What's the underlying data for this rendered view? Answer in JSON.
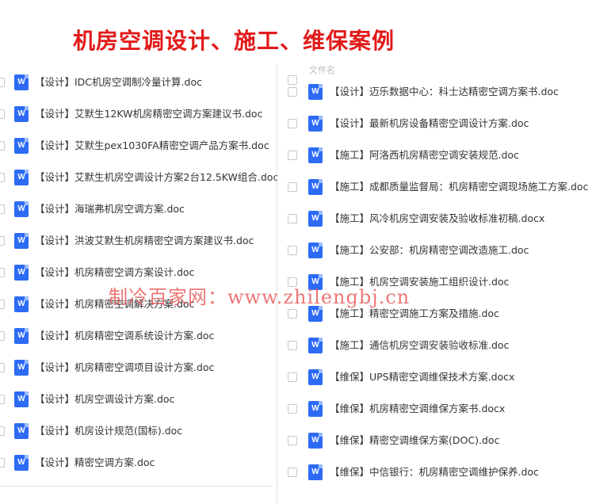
{
  "banner": {
    "title": "机房空调设计、施工、维保案例"
  },
  "right_header": {
    "label": "文件名"
  },
  "left_files": [
    "【设计】IDC机房空调制冷量计算.doc",
    "【设计】艾默生12KW机房精密空调方案建议书.doc",
    "【设计】艾默生pex1030FA精密空调产品方案书.doc",
    "【设计】艾默生机房空调设计方案2台12.5KW组合.doc",
    "【设计】海瑞弗机房空调方案.doc",
    "【设计】洪波艾默生机房精密空调方案建议书.doc",
    "【设计】机房精密空调方案设计.doc",
    "【设计】机房精密空调解决方案.doc",
    "【设计】机房精密空调系统设计方案.doc",
    "【设计】机房精密空调项目设计方案.doc",
    "【设计】机房空调设计方案.doc",
    "【设计】机房设计规范(国标).doc",
    "【设计】精密空调方案.doc"
  ],
  "right_files": [
    "【设计】迈乐数据中心：科士达精密空调方案书.doc",
    "【设计】最新机房设备精密空调设计方案.doc",
    "【施工】阿洛西机房精密空调安装规范.doc",
    "【施工】成都质量监督局：机房精密空调现场施工方案.doc",
    "【施工】风冷机房空调安装及验收标准初稿.docx",
    "【施工】公安部：机房精密空调改造施工.doc",
    "【施工】机房空调安装施工组织设计.doc",
    "【施工】精密空调施工方案及措施.doc",
    "【施工】通信机房空调安装验收标准.doc",
    "【维保】UPS精密空调维保技术方案.docx",
    "【维保】机房精密空调维保方案书.docx",
    "【维保】精密空调维保方案(DOC).doc",
    "【维保】中信银行：机房精密空调维护保养.doc"
  ],
  "icon": {
    "name": "word-doc-icon",
    "letter": "W",
    "color": "#2d6bf5"
  },
  "watermark": {
    "text": "制冷百家网：www.zhilengbj.cn",
    "color": "#e85050"
  },
  "colors": {
    "banner": "#e21a1a",
    "text": "#333333"
  }
}
